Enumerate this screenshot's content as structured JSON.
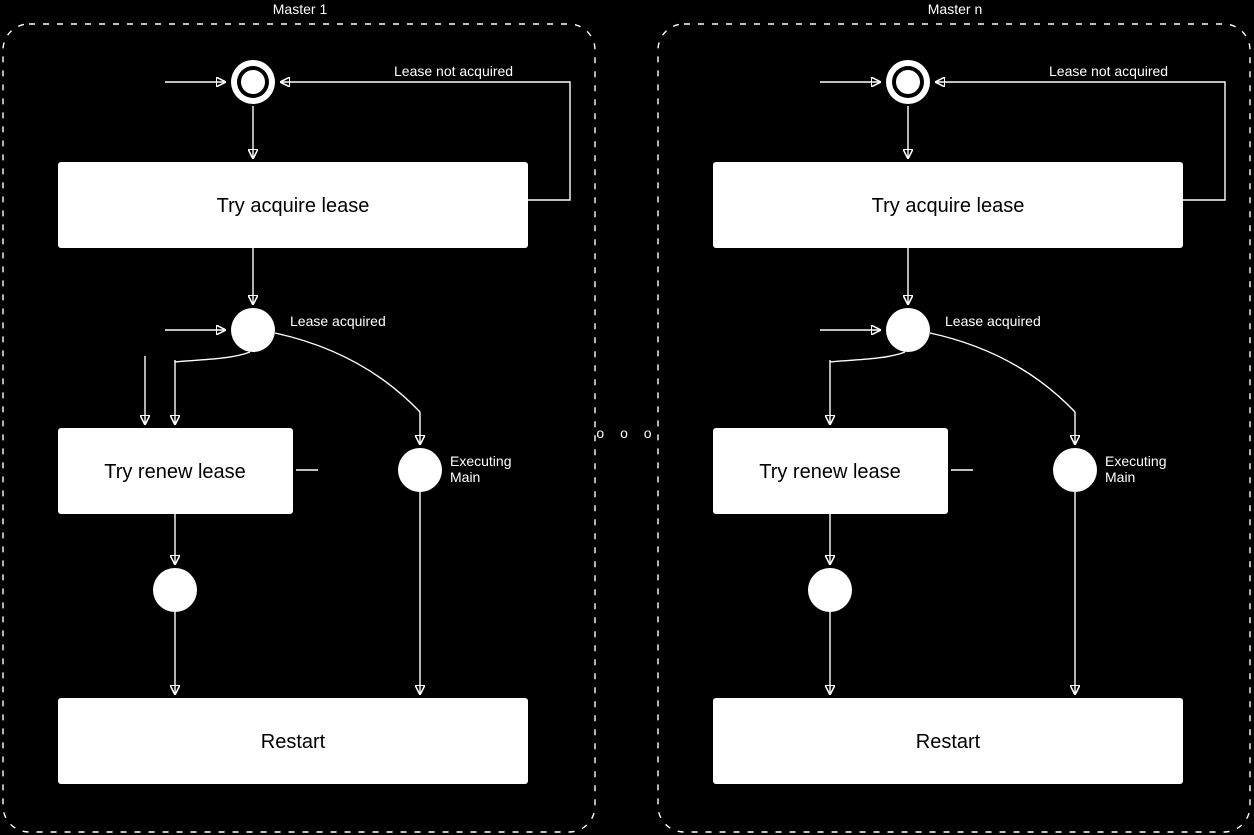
{
  "diagram": {
    "separator_label": "o o o",
    "columns": [
      {
        "title": "Master 1",
        "lease_not_acquired": "Lease not acquired",
        "try_acquire": "Try acquire lease",
        "lease_acquired": "Lease acquired",
        "try_renew": "Try renew lease",
        "executing_main_l1": "Executing",
        "executing_main_l2": "Main",
        "restart": "Restart"
      },
      {
        "title": "Master n",
        "lease_not_acquired": "Lease not acquired",
        "try_acquire": "Try acquire lease",
        "lease_acquired": "Lease acquired",
        "try_renew": "Try renew lease",
        "executing_main_l1": "Executing",
        "executing_main_l2": "Main",
        "restart": "Restart"
      }
    ]
  }
}
